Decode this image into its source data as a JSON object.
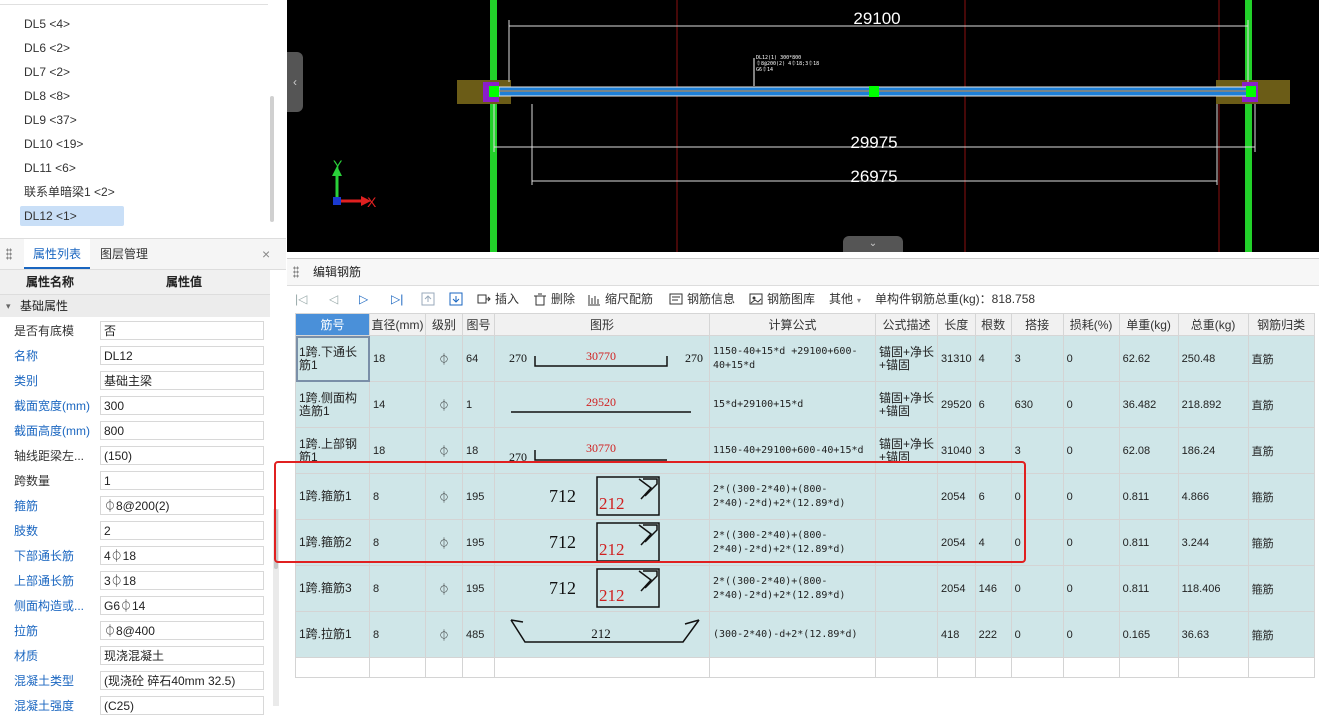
{
  "tree": {
    "items": [
      {
        "label": "DL5 <4>",
        "selected": false
      },
      {
        "label": "DL6 <2>",
        "selected": false
      },
      {
        "label": "DL7 <2>",
        "selected": false
      },
      {
        "label": "DL8 <8>",
        "selected": false
      },
      {
        "label": "DL9 <37>",
        "selected": false
      },
      {
        "label": "DL10 <19>",
        "selected": false
      },
      {
        "label": "DL11 <6>",
        "selected": false
      },
      {
        "label": "联系单暗梁1 <2>",
        "selected": false
      },
      {
        "label": "DL12 <1>",
        "selected": true
      }
    ]
  },
  "props_panel": {
    "tab_properties": "属性列表",
    "tab_layers": "图层管理",
    "close": "×",
    "col_name": "属性名称",
    "col_value": "属性值",
    "group": "基础属性",
    "rows": [
      {
        "name": "是否有底模",
        "value": "否",
        "blue": false
      },
      {
        "name": "名称",
        "value": "DL12",
        "blue": true
      },
      {
        "name": "类别",
        "value": "基础主梁",
        "blue": true
      },
      {
        "name": "截面宽度(mm)",
        "value": "300",
        "blue": true
      },
      {
        "name": "截面高度(mm)",
        "value": "800",
        "blue": true
      },
      {
        "name": "轴线距梁左...",
        "value": "(150)",
        "blue": false
      },
      {
        "name": "跨数量",
        "value": "1",
        "blue": false
      },
      {
        "name": "箍筋",
        "value": "⏀8@200(2)",
        "blue": true
      },
      {
        "name": "肢数",
        "value": "2",
        "blue": true
      },
      {
        "name": "下部通长筋",
        "value": "4⏀18",
        "blue": true
      },
      {
        "name": "上部通长筋",
        "value": "3⏀18",
        "blue": true
      },
      {
        "name": "侧面构造或...",
        "value": "G6⏀14",
        "blue": true
      },
      {
        "name": "拉筋",
        "value": "⏀8@400",
        "blue": true
      },
      {
        "name": "材质",
        "value": "现浇混凝土",
        "blue": true
      },
      {
        "name": "混凝土类型",
        "value": "(现浇砼 碎石40mm 32.5)",
        "blue": true
      },
      {
        "name": "混凝土强度",
        "value": "(C25)",
        "blue": true
      }
    ]
  },
  "cad": {
    "dim_top": "29100",
    "dim_mid": "29975",
    "dim_bottom": "26975",
    "axis_x": "X",
    "axis_y": "Y",
    "label_lines": [
      "DL12(1) 300*800",
      "⏀8@200(2) 4⏀18;3⏀18",
      "G6⏀14"
    ],
    "colors": {
      "column": "#22d12a",
      "beam": "#1e7fd6",
      "node": "#00ff00",
      "support": "#7b6a1e",
      "gridline": "#a01010"
    }
  },
  "editor": {
    "title": "编辑钢筋",
    "toolbar": {
      "insert": "插入",
      "delete": "删除",
      "scale": "缩尺配筋",
      "info": "钢筋信息",
      "library": "钢筋图库",
      "other": "其他",
      "total": "单构件钢筋总重(kg)：818.758"
    },
    "columns": [
      "筋号",
      "直径(mm)",
      "级别",
      "图号",
      "图形",
      "计算公式",
      "公式描述",
      "长度",
      "根数",
      "搭接",
      "损耗(%)",
      "单重(kg)",
      "总重(kg)",
      "钢筋归类"
    ],
    "rows": [
      {
        "no": "1",
        "name": "1跨.下通长筋1",
        "dia": "18",
        "grade": "⏀",
        "fig": "64",
        "shape": "straight_hooks",
        "shape_left": "270",
        "shape_mid": "30770",
        "shape_right": "270",
        "formula": "1150-40+15*d +29100+600-40+15*d",
        "desc": "锚固+净长+锚固",
        "len": "31310",
        "count": "4",
        "lap": "3",
        "loss": "0",
        "unit_w": "62.62",
        "total_w": "250.48",
        "type": "直筋"
      },
      {
        "no": "2",
        "name": "1跨.侧面构造筋1",
        "dia": "14",
        "grade": "⏀",
        "fig": "1",
        "shape": "straight",
        "shape_left": "",
        "shape_mid": "29520",
        "shape_right": "",
        "formula": "15*d+29100+15*d",
        "desc": "锚固+净长+锚固",
        "len": "29520",
        "count": "6",
        "lap": "630",
        "loss": "0",
        "unit_w": "36.482",
        "total_w": "218.892",
        "type": "直筋"
      },
      {
        "no": "3",
        "name": "1跨.上部钢筋1",
        "dia": "18",
        "grade": "⏀",
        "fig": "18",
        "shape": "hook_left",
        "shape_left": "270",
        "shape_mid": "30770",
        "shape_right": "",
        "formula": "1150-40+29100+600-40+15*d",
        "desc": "锚固+净长+锚固",
        "len": "31040",
        "count": "3",
        "lap": "3",
        "loss": "0",
        "unit_w": "62.08",
        "total_w": "186.24",
        "type": "直筋"
      },
      {
        "no": "4",
        "name": "1跨.箍筋1",
        "dia": "8",
        "grade": "⏀",
        "fig": "195",
        "shape": "stirrup",
        "shape_left": "712",
        "shape_mid": "212",
        "shape_right": "",
        "formula": "2*((300-2*40)+(800-2*40)-2*d)+2*(12.89*d)",
        "desc": "",
        "len": "2054",
        "count": "6",
        "lap": "0",
        "loss": "0",
        "unit_w": "0.811",
        "total_w": "4.866",
        "type": "箍筋"
      },
      {
        "no": "5",
        "name": "1跨.箍筋2",
        "dia": "8",
        "grade": "⏀",
        "fig": "195",
        "shape": "stirrup",
        "shape_left": "712",
        "shape_mid": "212",
        "shape_right": "",
        "formula": "2*((300-2*40)+(800-2*40)-2*d)+2*(12.89*d)",
        "desc": "",
        "len": "2054",
        "count": "4",
        "lap": "0",
        "loss": "0",
        "unit_w": "0.811",
        "total_w": "3.244",
        "type": "箍筋"
      },
      {
        "no": "6",
        "name": "1跨.箍筋3",
        "dia": "8",
        "grade": "⏀",
        "fig": "195",
        "shape": "stirrup",
        "shape_left": "712",
        "shape_mid": "212",
        "shape_right": "",
        "formula": "2*((300-2*40)+(800-2*40)-2*d)+2*(12.89*d)",
        "desc": "",
        "len": "2054",
        "count": "146",
        "lap": "0",
        "loss": "0",
        "unit_w": "0.811",
        "total_w": "118.406",
        "type": "箍筋"
      },
      {
        "no": "7",
        "name": "1跨.拉筋1",
        "dia": "8",
        "grade": "⏀",
        "fig": "485",
        "shape": "tie",
        "shape_left": "",
        "shape_mid": "212",
        "shape_right": "",
        "formula": "(300-2*40)-d+2*(12.89*d)",
        "desc": "",
        "len": "418",
        "count": "222",
        "lap": "0",
        "loss": "0",
        "unit_w": "0.165",
        "total_w": "36.63",
        "type": "箍筋"
      }
    ],
    "empty_row_no": "8"
  }
}
